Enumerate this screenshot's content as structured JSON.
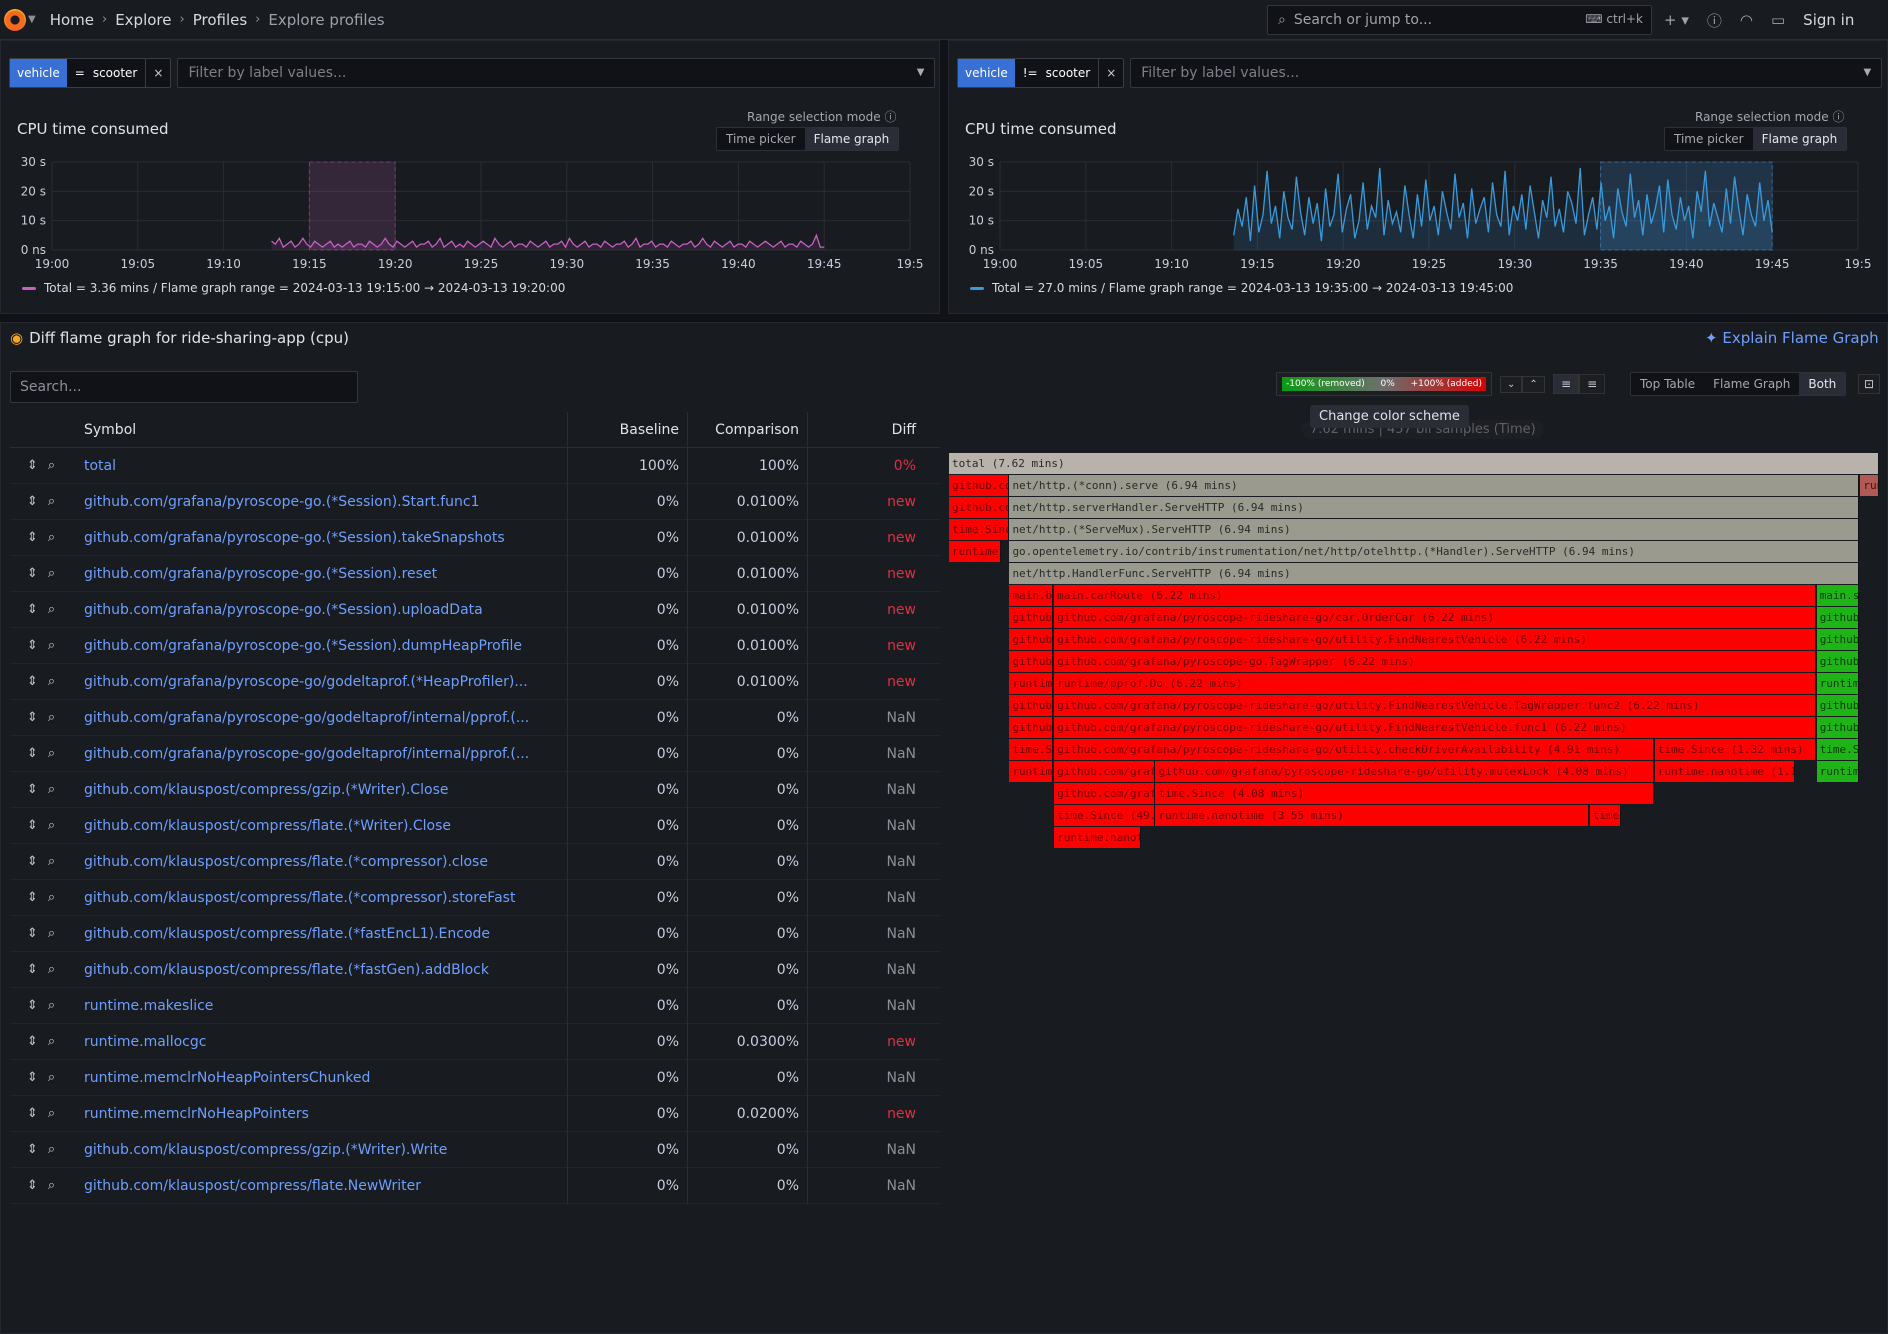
{
  "breadcrumb": [
    "Home",
    "Explore",
    "Profiles",
    "Explore profiles"
  ],
  "search": {
    "placeholder": "Search or jump to...",
    "shortcut": "ctrl+k"
  },
  "signin": "Sign in",
  "left": {
    "filter": {
      "label": "vehicle",
      "op": "=",
      "value": "scooter",
      "remove": "×"
    },
    "filter_placeholder": "Filter by label values...",
    "title": "CPU time consumed",
    "range_mode_label": "Range selection mode",
    "range_options": [
      "Time picker",
      "Flame graph"
    ],
    "legend": "Total = 3.36 mins / Flame graph range = 2024-03-13 19:15:00 → 2024-03-13 19:20:00",
    "color": "#c760c7"
  },
  "right": {
    "filter": {
      "label": "vehicle",
      "op": "!=",
      "value": "scooter",
      "remove": "×"
    },
    "filter_placeholder": "Filter by label values...",
    "title": "CPU time consumed",
    "range_mode_label": "Range selection mode",
    "range_options": [
      "Time picker",
      "Flame graph"
    ],
    "legend": "Total = 27.0 mins / Flame graph range = 2024-03-13 19:35:00 → 2024-03-13 19:45:00",
    "color": "#3a9bdc"
  },
  "chart_data": [
    {
      "type": "line",
      "title": "CPU time consumed",
      "y_ticks": [
        "0 ns",
        "10 s",
        "20 s",
        "30 s"
      ],
      "x_ticks": [
        "19:00",
        "19:05",
        "19:10",
        "19:15",
        "19:20",
        "19:25",
        "19:30",
        "19:35",
        "19:40",
        "19:45",
        "19:5"
      ],
      "ylim": [
        0,
        30
      ],
      "selection": [
        "19:15",
        "19:20"
      ],
      "series": [
        {
          "values": [
            0,
            0,
            0,
            0,
            0,
            0,
            0,
            0,
            0,
            0,
            0,
            0,
            0,
            0,
            0,
            0,
            0,
            0,
            0,
            0,
            0,
            0,
            0,
            0,
            0,
            0,
            0,
            0,
            0,
            0,
            0,
            0,
            0,
            0,
            0,
            0,
            0,
            0,
            0,
            0,
            0,
            0,
            0,
            0,
            0,
            0,
            0,
            0,
            0,
            0,
            0,
            0,
            0,
            0,
            0,
            0,
            3,
            2,
            4,
            1,
            2,
            3,
            1,
            2,
            4,
            2,
            1,
            3,
            2,
            1,
            2,
            3,
            1,
            2,
            1,
            2,
            3,
            1,
            2,
            2,
            1,
            3,
            2,
            1,
            2,
            4,
            2,
            1,
            3,
            2,
            1,
            2,
            3,
            1,
            2,
            2,
            3,
            1,
            2,
            4,
            1,
            2,
            3,
            1,
            2,
            1,
            3,
            2,
            1,
            2,
            3,
            2,
            1,
            4,
            2,
            1,
            2,
            3,
            1,
            2,
            2,
            1,
            3,
            2,
            1,
            2,
            3,
            1,
            2,
            2,
            3,
            1,
            4,
            2,
            1,
            2,
            3,
            1,
            2,
            2,
            1,
            3,
            2,
            1,
            2,
            2,
            3,
            1,
            2,
            4,
            1,
            2,
            2,
            3,
            1,
            2,
            2,
            1,
            3,
            2,
            1,
            2,
            2,
            3,
            1,
            2,
            4,
            2,
            1,
            3,
            2,
            1,
            2,
            3,
            1,
            2,
            2,
            1,
            3,
            2,
            1,
            2,
            3,
            2,
            1,
            2,
            3,
            1,
            2,
            2,
            1,
            3,
            2,
            1,
            2,
            5,
            1,
            1
          ]
        }
      ]
    },
    {
      "type": "line",
      "title": "CPU time consumed",
      "y_ticks": [
        "0 ns",
        "10 s",
        "20 s",
        "30 s"
      ],
      "x_ticks": [
        "19:00",
        "19:05",
        "19:10",
        "19:15",
        "19:20",
        "19:25",
        "19:30",
        "19:35",
        "19:40",
        "19:45",
        "19:5"
      ],
      "ylim": [
        0,
        30
      ],
      "selection": [
        "19:35",
        "19:45"
      ],
      "series": [
        {
          "values": [
            0,
            0,
            0,
            0,
            0,
            0,
            0,
            0,
            0,
            0,
            0,
            0,
            0,
            0,
            0,
            0,
            0,
            0,
            0,
            0,
            0,
            0,
            0,
            0,
            0,
            0,
            0,
            0,
            0,
            0,
            0,
            0,
            0,
            0,
            0,
            0,
            0,
            0,
            0,
            0,
            0,
            0,
            0,
            0,
            0,
            0,
            0,
            0,
            0,
            0,
            0,
            0,
            0,
            0,
            0,
            0,
            5,
            14,
            8,
            18,
            3,
            22,
            6,
            12,
            27,
            9,
            15,
            4,
            20,
            11,
            7,
            25,
            13,
            5,
            18,
            9,
            16,
            3,
            21,
            8,
            12,
            26,
            6,
            14,
            19,
            4,
            10,
            23,
            7,
            15,
            11,
            28,
            5,
            17,
            9,
            13,
            6,
            22,
            12,
            4,
            19,
            8,
            24,
            10,
            15,
            5,
            20,
            13,
            7,
            26,
            11,
            16,
            4,
            21,
            9,
            14,
            18,
            6,
            23,
            12,
            8,
            27,
            5,
            15,
            10,
            19,
            7,
            22,
            13,
            4,
            17,
            11,
            25,
            8,
            14,
            6,
            20,
            16,
            9,
            28,
            5,
            12,
            18,
            7,
            23,
            10,
            15,
            4,
            21,
            13,
            8,
            26,
            11,
            17,
            5,
            19,
            9,
            14,
            22,
            6,
            24,
            12,
            7,
            18,
            10,
            15,
            4,
            20,
            13,
            27,
            8,
            16,
            11,
            6,
            21,
            9,
            25,
            14,
            5,
            19,
            12,
            8,
            23,
            10,
            17,
            6
          ]
        }
      ]
    }
  ],
  "flamegraph": {
    "title": "Diff flame graph for ride-sharing-app (cpu)",
    "explain": "Explain Flame Graph",
    "search_placeholder": "Search...",
    "scheme": {
      "removed": "-100% (removed)",
      "zero": "0%",
      "added": "+100% (added)"
    },
    "tooltip": "Change color scheme",
    "samples": "7.62 mins | 457 bil samples (Time)",
    "views": [
      "Top Table",
      "Flame Graph",
      "Both"
    ]
  },
  "table": {
    "headers": {
      "symbol": "Symbol",
      "baseline": "Baseline",
      "comparison": "Comparison",
      "diff": "Diff"
    },
    "rows": [
      {
        "symbol": "total",
        "baseline": "100%",
        "comparison": "100%",
        "diff": "0%"
      },
      {
        "symbol": "github.com/grafana/pyroscope-go.(*Session).Start.func1",
        "baseline": "0%",
        "comparison": "0.0100%",
        "diff": "new"
      },
      {
        "symbol": "github.com/grafana/pyroscope-go.(*Session).takeSnapshots",
        "baseline": "0%",
        "comparison": "0.0100%",
        "diff": "new"
      },
      {
        "symbol": "github.com/grafana/pyroscope-go.(*Session).reset",
        "baseline": "0%",
        "comparison": "0.0100%",
        "diff": "new"
      },
      {
        "symbol": "github.com/grafana/pyroscope-go.(*Session).uploadData",
        "baseline": "0%",
        "comparison": "0.0100%",
        "diff": "new"
      },
      {
        "symbol": "github.com/grafana/pyroscope-go.(*Session).dumpHeapProfile",
        "baseline": "0%",
        "comparison": "0.0100%",
        "diff": "new"
      },
      {
        "symbol": "github.com/grafana/pyroscope-go/godeltaprof.(*HeapProfiler)...",
        "baseline": "0%",
        "comparison": "0.0100%",
        "diff": "new"
      },
      {
        "symbol": "github.com/grafana/pyroscope-go/godeltaprof/internal/pprof.(...",
        "baseline": "0%",
        "comparison": "0%",
        "diff": "NaN"
      },
      {
        "symbol": "github.com/grafana/pyroscope-go/godeltaprof/internal/pprof.(...",
        "baseline": "0%",
        "comparison": "0%",
        "diff": "NaN"
      },
      {
        "symbol": "github.com/klauspost/compress/gzip.(*Writer).Close",
        "baseline": "0%",
        "comparison": "0%",
        "diff": "NaN"
      },
      {
        "symbol": "github.com/klauspost/compress/flate.(*Writer).Close",
        "baseline": "0%",
        "comparison": "0%",
        "diff": "NaN"
      },
      {
        "symbol": "github.com/klauspost/compress/flate.(*compressor).close",
        "baseline": "0%",
        "comparison": "0%",
        "diff": "NaN"
      },
      {
        "symbol": "github.com/klauspost/compress/flate.(*compressor).storeFast",
        "baseline": "0%",
        "comparison": "0%",
        "diff": "NaN"
      },
      {
        "symbol": "github.com/klauspost/compress/flate.(*fastEncL1).Encode",
        "baseline": "0%",
        "comparison": "0%",
        "diff": "NaN"
      },
      {
        "symbol": "github.com/klauspost/compress/flate.(*fastGen).addBlock",
        "baseline": "0%",
        "comparison": "0%",
        "diff": "NaN"
      },
      {
        "symbol": "runtime.makeslice",
        "baseline": "0%",
        "comparison": "0%",
        "diff": "NaN"
      },
      {
        "symbol": "runtime.mallocgc",
        "baseline": "0%",
        "comparison": "0.0300%",
        "diff": "new"
      },
      {
        "symbol": "runtime.memclrNoHeapPointersChunked",
        "baseline": "0%",
        "comparison": "0%",
        "diff": "NaN"
      },
      {
        "symbol": "runtime.memclrNoHeapPointers",
        "baseline": "0%",
        "comparison": "0.0200%",
        "diff": "new"
      },
      {
        "symbol": "github.com/klauspost/compress/gzip.(*Writer).Write",
        "baseline": "0%",
        "comparison": "0%",
        "diff": "NaN"
      },
      {
        "symbol": "github.com/klauspost/compress/flate.NewWriter",
        "baseline": "0%",
        "comparison": "0%",
        "diff": "NaN"
      }
    ]
  },
  "flame_frames": [
    {
      "label": "total (7.62 mins)",
      "kind": "grey",
      "depth": 0,
      "start": 0,
      "end": 1
    },
    {
      "label": "github.co",
      "kind": "red",
      "depth": 1,
      "start": 0,
      "end": 0.064
    },
    {
      "label": "net/http.(*conn).serve (6.94 mins)",
      "kind": "grey",
      "depth": 1,
      "start": 0.065,
      "end": 0.979
    },
    {
      "label": "run",
      "kind": "redish",
      "depth": 1,
      "start": 0.98,
      "end": 1
    },
    {
      "label": "github.co",
      "kind": "red",
      "depth": 2,
      "start": 0,
      "end": 0.064
    },
    {
      "label": "net/http.serverHandler.ServeHTTP (6.94 mins)",
      "kind": "grey",
      "depth": 2,
      "start": 0.065,
      "end": 0.979
    },
    {
      "label": "time.Since",
      "kind": "red",
      "depth": 3,
      "start": 0,
      "end": 0.064
    },
    {
      "label": "net/http.(*ServeMux).ServeHTTP (6.94 mins)",
      "kind": "grey",
      "depth": 3,
      "start": 0.065,
      "end": 0.979
    },
    {
      "label": "runtime",
      "kind": "red",
      "depth": 4,
      "start": 0,
      "end": 0.056
    },
    {
      "label": "go.opentelemetry.io/contrib/instrumentation/net/http/otelhttp.(*Handler).ServeHTTP (6.94 mins)",
      "kind": "grey",
      "depth": 4,
      "start": 0.065,
      "end": 0.979
    },
    {
      "label": "net/http.HandlerFunc.ServeHTTP (6.94 mins)",
      "kind": "grey",
      "depth": 5,
      "start": 0.065,
      "end": 0.979
    },
    {
      "label": "main.b",
      "kind": "red",
      "depth": 6,
      "start": 0.065,
      "end": 0.112
    },
    {
      "label": "main.carRoute (6.22 mins)",
      "kind": "red",
      "depth": 6,
      "start": 0.113,
      "end": 0.932
    },
    {
      "label": "main.s",
      "kind": "green",
      "depth": 6,
      "start": 0.933,
      "end": 0.979
    },
    {
      "label": "github",
      "kind": "red",
      "depth": 7,
      "start": 0.065,
      "end": 0.112
    },
    {
      "label": "github.com/grafana/pyroscope-rideshare-go/car.OrderCar (6.22 mins)",
      "kind": "red",
      "depth": 7,
      "start": 0.113,
      "end": 0.932
    },
    {
      "label": "github",
      "kind": "green",
      "depth": 7,
      "start": 0.933,
      "end": 0.979
    },
    {
      "label": "github",
      "kind": "red",
      "depth": 8,
      "start": 0.065,
      "end": 0.112
    },
    {
      "label": "github.com/grafana/pyroscope-rideshare-go/utility.FindNearestVehicle (6.22 mins)",
      "kind": "red",
      "depth": 8,
      "start": 0.113,
      "end": 0.932
    },
    {
      "label": "github",
      "kind": "green",
      "depth": 8,
      "start": 0.933,
      "end": 0.979
    },
    {
      "label": "github",
      "kind": "red",
      "depth": 9,
      "start": 0.065,
      "end": 0.112
    },
    {
      "label": "github.com/grafana/pyroscope-go.TagWrapper (6.22 mins)",
      "kind": "red",
      "depth": 9,
      "start": 0.113,
      "end": 0.932
    },
    {
      "label": "github",
      "kind": "green",
      "depth": 9,
      "start": 0.933,
      "end": 0.979
    },
    {
      "label": "runtime",
      "kind": "red",
      "depth": 10,
      "start": 0.065,
      "end": 0.112
    },
    {
      "label": "runtime/pprof.Do (6.22 mins)",
      "kind": "red",
      "depth": 10,
      "start": 0.113,
      "end": 0.932
    },
    {
      "label": "runtime",
      "kind": "green",
      "depth": 10,
      "start": 0.933,
      "end": 0.979
    },
    {
      "label": "github",
      "kind": "red",
      "depth": 11,
      "start": 0.065,
      "end": 0.112
    },
    {
      "label": "github.com/grafana/pyroscope-rideshare-go/utility.FindNearestVehicle.TagWrapper.func2 (6.22 mins)",
      "kind": "red",
      "depth": 11,
      "start": 0.113,
      "end": 0.932
    },
    {
      "label": "github",
      "kind": "green",
      "depth": 11,
      "start": 0.933,
      "end": 0.979
    },
    {
      "label": "github",
      "kind": "red",
      "depth": 12,
      "start": 0.065,
      "end": 0.112
    },
    {
      "label": "github.com/grafana/pyroscope-rideshare-go/utility.FindNearestVehicle.func1 (6.22 mins)",
      "kind": "red",
      "depth": 12,
      "start": 0.113,
      "end": 0.932
    },
    {
      "label": "github",
      "kind": "green",
      "depth": 12,
      "start": 0.933,
      "end": 0.979
    },
    {
      "label": "time.S",
      "kind": "red",
      "depth": 13,
      "start": 0.065,
      "end": 0.112
    },
    {
      "label": "github.com/grafana/pyroscope-rideshare-go/utility.checkDriverAvailability (4.91 mins)",
      "kind": "red",
      "depth": 13,
      "start": 0.113,
      "end": 0.758
    },
    {
      "label": "time.Since (1.32 mins)",
      "kind": "red",
      "depth": 13,
      "start": 0.759,
      "end": 0.932
    },
    {
      "label": "time.S",
      "kind": "green",
      "depth": 13,
      "start": 0.933,
      "end": 0.979
    },
    {
      "label": "runtim",
      "kind": "red",
      "depth": 14,
      "start": 0.065,
      "end": 0.112
    },
    {
      "label": "github.com/grafa",
      "kind": "red",
      "depth": 14,
      "start": 0.113,
      "end": 0.221
    },
    {
      "label": "github.com/grafana/pyroscope-rideshare-go/utility.mutexLock (4.08 mins)",
      "kind": "red",
      "depth": 14,
      "start": 0.222,
      "end": 0.758
    },
    {
      "label": "runtime.nanotime (1.14",
      "kind": "red",
      "depth": 14,
      "start": 0.759,
      "end": 0.91
    },
    {
      "label": "runtim",
      "kind": "green",
      "depth": 14,
      "start": 0.933,
      "end": 0.979
    },
    {
      "label": "github.com/grafa",
      "kind": "red",
      "depth": 15,
      "start": 0.113,
      "end": 0.221
    },
    {
      "label": "time.Since (4.08 mins)",
      "kind": "red",
      "depth": 15,
      "start": 0.222,
      "end": 0.758
    },
    {
      "label": "time.Since (49.6",
      "kind": "red",
      "depth": 16,
      "start": 0.113,
      "end": 0.221
    },
    {
      "label": "runtime.nanotime (3.55 mins)",
      "kind": "red",
      "depth": 16,
      "start": 0.222,
      "end": 0.688
    },
    {
      "label": "time.",
      "kind": "red",
      "depth": 16,
      "start": 0.689,
      "end": 0.723
    },
    {
      "label": "runtime.nanot",
      "kind": "red",
      "depth": 17,
      "start": 0.113,
      "end": 0.207
    }
  ]
}
